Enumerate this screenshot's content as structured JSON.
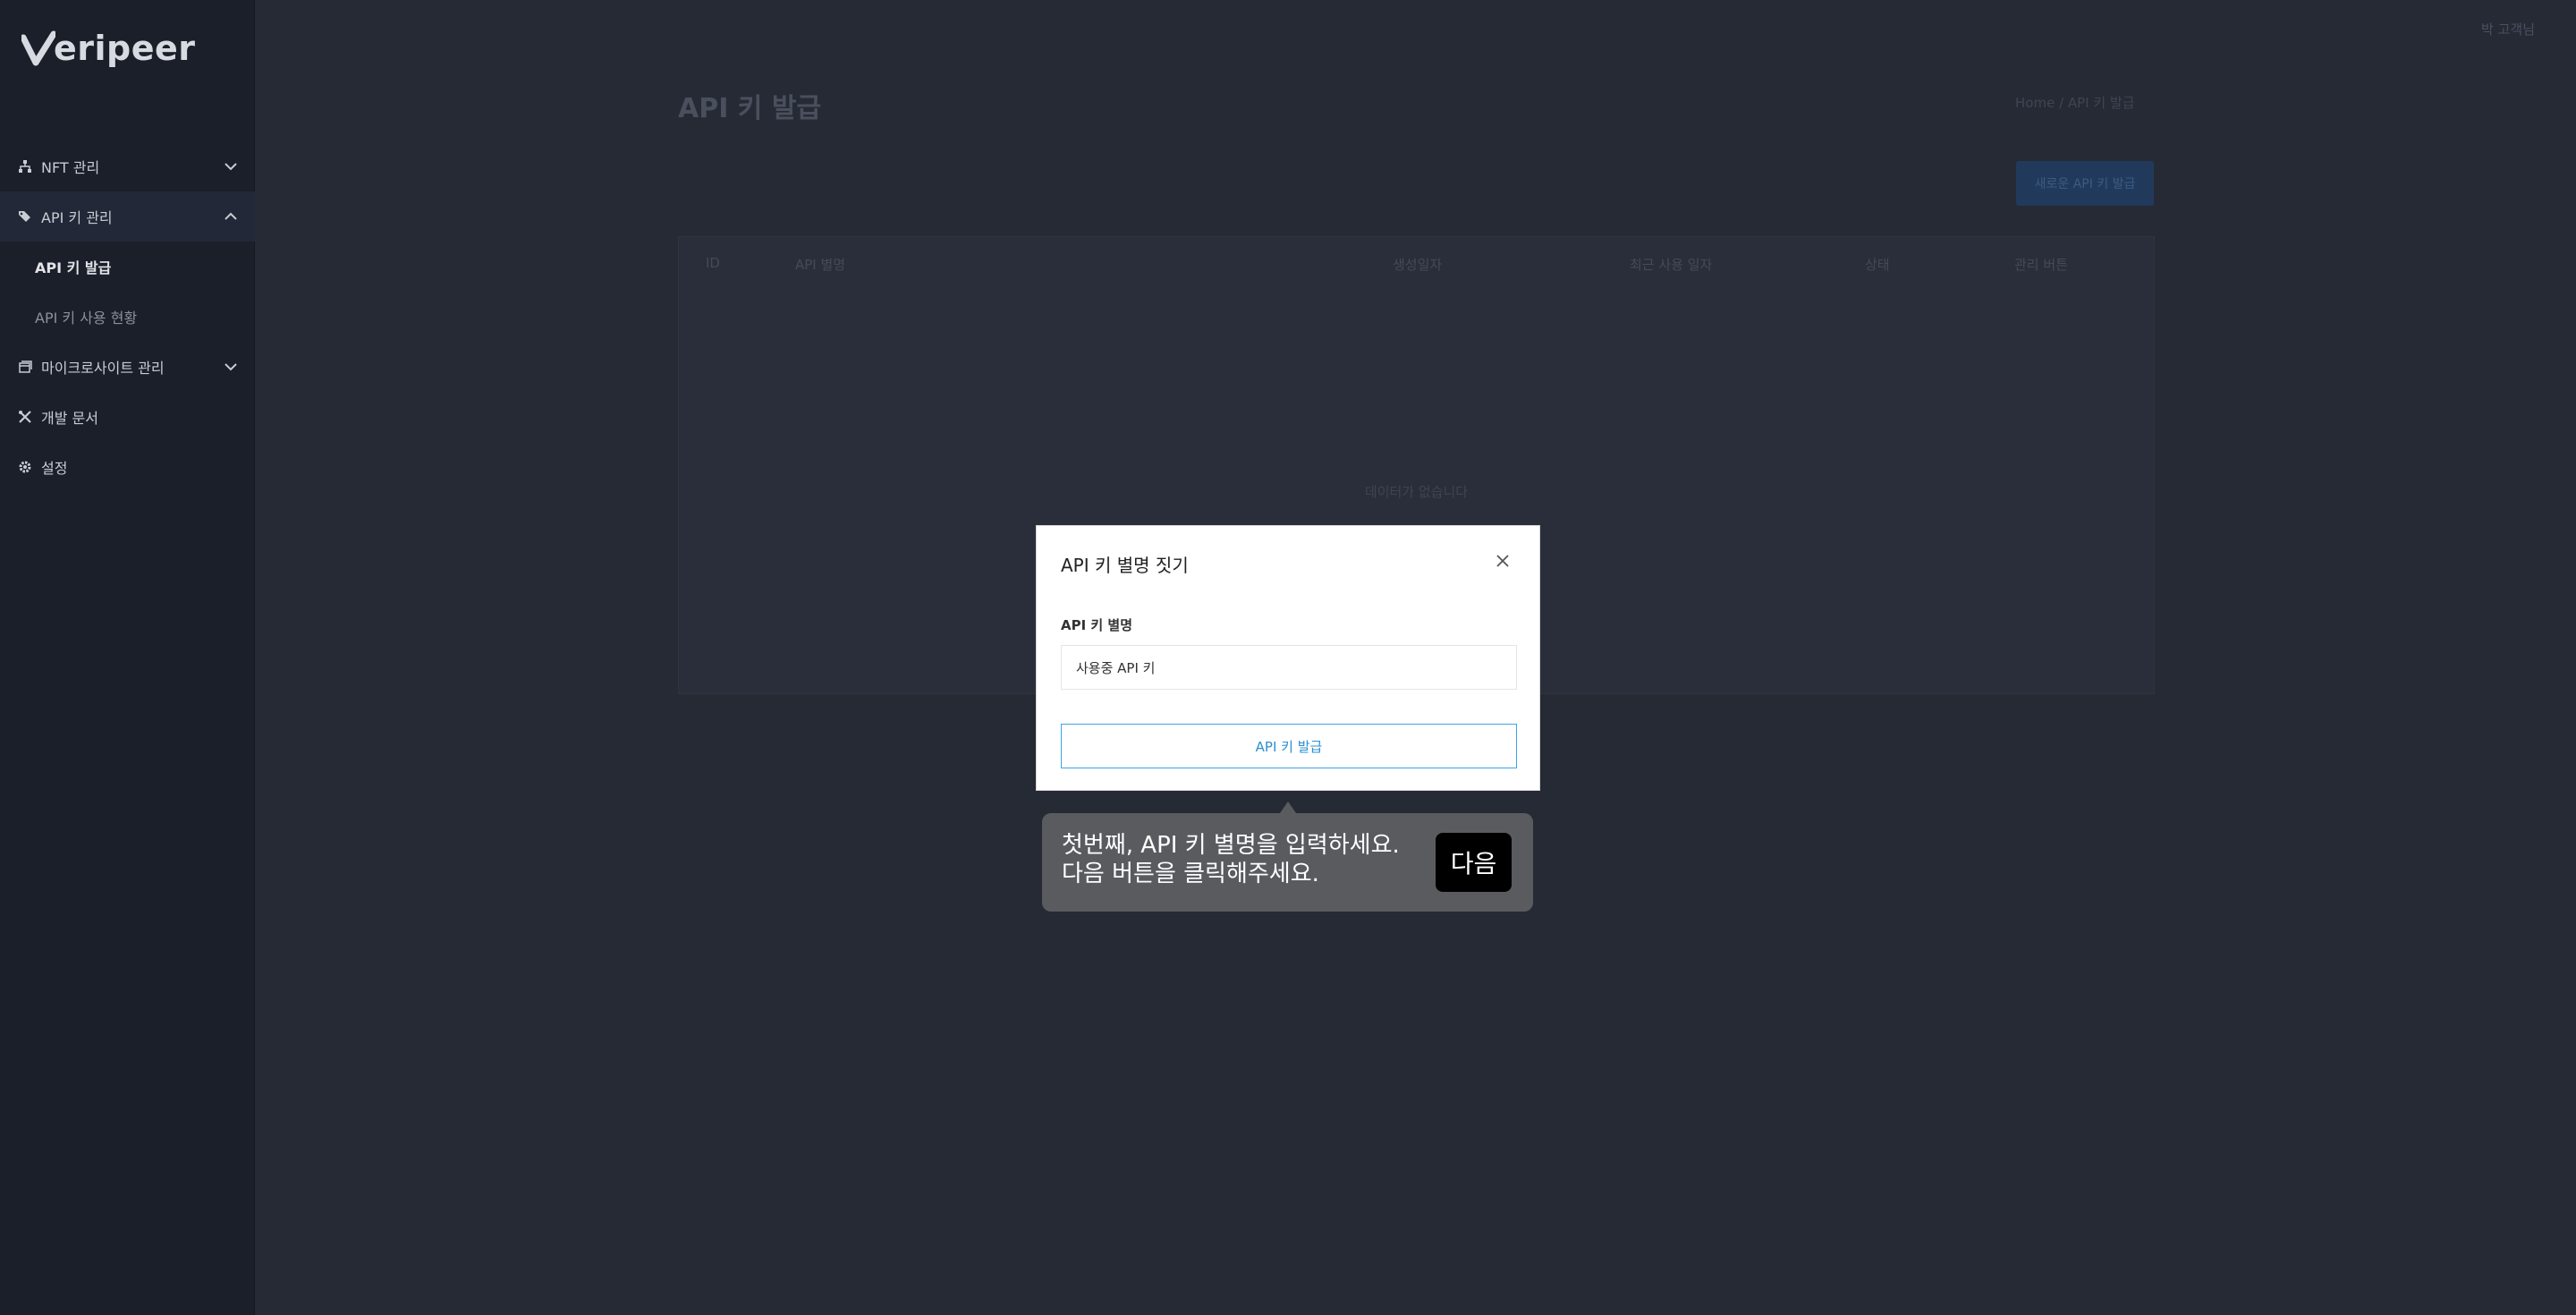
{
  "brand": {
    "name": "eripeer",
    "logo_mark": "V"
  },
  "sidebar": {
    "items": [
      {
        "label": "NFT 관리",
        "icon": "sitemap-icon",
        "expanded": false
      },
      {
        "label": "API 키 관리",
        "icon": "tags-icon",
        "expanded": true,
        "children": [
          {
            "label": "API 키 발급",
            "active": true
          },
          {
            "label": "API 키 사용 현황",
            "active": false
          }
        ]
      },
      {
        "label": "마이크로사이트 관리",
        "icon": "window-icon",
        "expanded": false
      },
      {
        "label": "개발 문서",
        "icon": "tools-icon"
      },
      {
        "label": "설정",
        "icon": "gear-icon"
      }
    ]
  },
  "main": {
    "user_label": "박 고객님",
    "page_title": "API 키 발급",
    "breadcrumb": "Home / API 키 발급",
    "new_key_button": "새로운 API 키 발급",
    "table": {
      "headers": [
        "ID",
        "API 별명",
        "생성일자",
        "최근 사용 일자",
        "상태",
        "관리 버튼"
      ],
      "empty_message": "데이터가 없습니다"
    }
  },
  "modal": {
    "title": "API 키 별명 짓기",
    "field_label": "API 키 별명",
    "field_value": "사용중 API 키",
    "submit_label": "API 키 발급"
  },
  "tooltip": {
    "line1": "첫번째, API 키 별명을 입력하세요.",
    "line2": "다음 버튼을 클릭해주세요.",
    "next_label": "다음"
  },
  "colors": {
    "sidebar_bg": "#1a1f2a",
    "main_bg": "#262a35",
    "accent_blue": "#3ba7e6",
    "tooltip_bg": "#5a5b5f"
  }
}
